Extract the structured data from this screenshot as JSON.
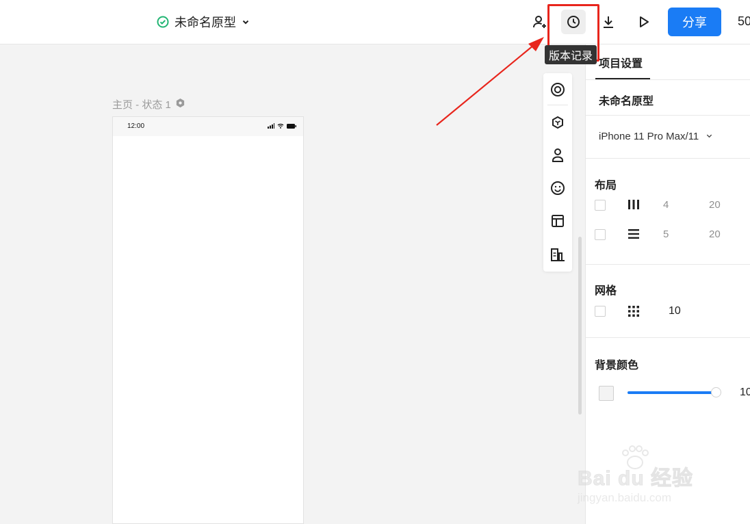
{
  "topbar": {
    "project_name": "未命名原型",
    "share_label": "分享",
    "zoom_text": "50",
    "icons": [
      "add-collaborator-icon",
      "version-history-icon",
      "download-icon",
      "play-icon"
    ]
  },
  "tooltip": {
    "text": "版本记录"
  },
  "canvas": {
    "frame_label": "主页 - 状态 1",
    "status_time": "12:00"
  },
  "side_tools": [
    "target-icon",
    "component-icon",
    "user-icon",
    "emoji-icon",
    "layout-icon",
    "chart-icon"
  ],
  "panel": {
    "tab": "项目设置",
    "project_name": "未命名原型",
    "device": "iPhone 11 Pro Max/11",
    "layout": {
      "title": "布局",
      "columns": {
        "count": "4",
        "gutter": "20"
      },
      "rows": {
        "count": "5",
        "gutter": "20"
      }
    },
    "grid": {
      "title": "网格",
      "size": "10"
    },
    "background": {
      "title": "背景颜色",
      "opacity": "10",
      "opacity_fraction": 0.95
    }
  },
  "watermark": {
    "main": "Bai du 经验",
    "sub": "jingyan.baidu.com"
  },
  "colors": {
    "accent": "#1a7cf5",
    "highlight": "#e8251c",
    "success": "#22b573"
  }
}
